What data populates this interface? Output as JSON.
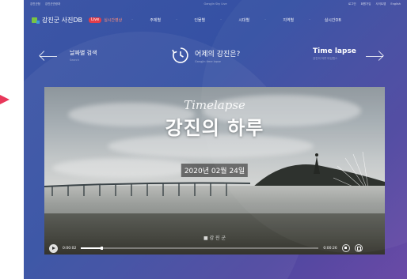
{
  "topbar": {
    "left_links": [
      "강진군청",
      "강진군관광과"
    ],
    "center_text": "Gangjin Sky Live",
    "right_links": [
      "로그인",
      "회원가입",
      "사이트맵",
      "English"
    ]
  },
  "nav": {
    "logo_text": "강진군 사진DB",
    "live_badge": "Live",
    "live_label": "실시간영상",
    "menu": [
      "주제별",
      "인물별",
      "시대별",
      "지역별",
      "실시간DB"
    ]
  },
  "search_row": {
    "date_search_label": "날짜별 검색",
    "date_search_sub": "Search",
    "yesterday_label": "어제의 강진은?",
    "yesterday_sub": "Gangjin time lapse",
    "timelapse_label": "Time lapse",
    "timelapse_sub": "강진의 하루 타임랩스"
  },
  "video": {
    "overlay_script": "Timelapse",
    "overlay_title": "강진의 하루",
    "overlay_date": "2020년 02월 24일",
    "watermark": "■ 강 진 군",
    "time_current": "0:00:02",
    "time_total": "0:00:26",
    "progress": 0.09
  },
  "icons": {
    "pointer": "arrow-pointer-icon",
    "back": "arrow-left-icon",
    "forward": "arrow-right-icon",
    "clock": "clock-icon",
    "share": "share-icon",
    "download": "download-icon",
    "pin": "pin-icon"
  },
  "colors": {
    "accent_red": "#e23d4a",
    "pointer": "#e8375a",
    "bg_blue": "#3d56a6",
    "bg_purple": "#6a4aa6",
    "logo_green": "#79c443"
  }
}
